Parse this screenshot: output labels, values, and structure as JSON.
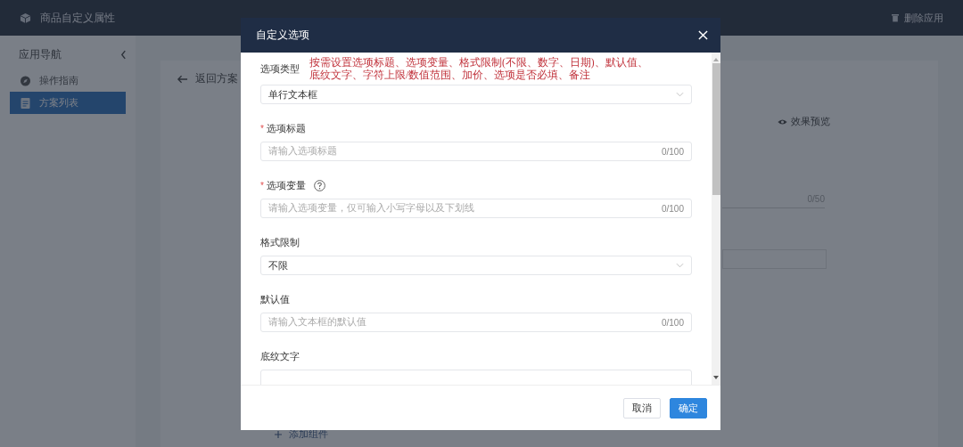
{
  "header": {
    "app_title": "商品自定义属性",
    "delete_button": "删除应用"
  },
  "sidebar": {
    "title": "应用导航",
    "items": [
      {
        "label": "操作指南",
        "kind": "guide",
        "selected": false
      },
      {
        "label": "方案列表",
        "kind": "list",
        "selected": true
      }
    ]
  },
  "content": {
    "back_link": "返回方案",
    "preview_button": "效果预览",
    "counter": "0/50",
    "add_button": "添加组件"
  },
  "dialog": {
    "title": "自定义选项",
    "annotation": [
      "按需设置选项标题、选项变量、格式限制(不限、数字、日期)、默认值、",
      "底纹文字、字符上限/数值范围、加价、选项是否必填、备注"
    ],
    "fields": [
      {
        "kind": "select",
        "label": "选项类型",
        "value": "单行文本框",
        "help": false
      },
      {
        "kind": "input",
        "label": "选项标题",
        "placeholder": "请输入选项标题",
        "counter": "0/100",
        "required_mark": "*",
        "help": false
      },
      {
        "kind": "input",
        "label": "选项变量",
        "placeholder": "请输入选项变量，仅可输入小写字母以及下划线",
        "counter": "0/100",
        "required_mark": "*",
        "help": true
      },
      {
        "kind": "select",
        "label": "格式限制",
        "value": "不限",
        "help": false
      },
      {
        "kind": "input",
        "label": "默认值",
        "placeholder": "请输入文本框的默认值",
        "counter": "0/100",
        "help": false
      },
      {
        "kind": "input",
        "label": "底纹文字",
        "help": false
      }
    ],
    "buttons": {
      "cancel": "取消",
      "confirm": "确定"
    }
  }
}
